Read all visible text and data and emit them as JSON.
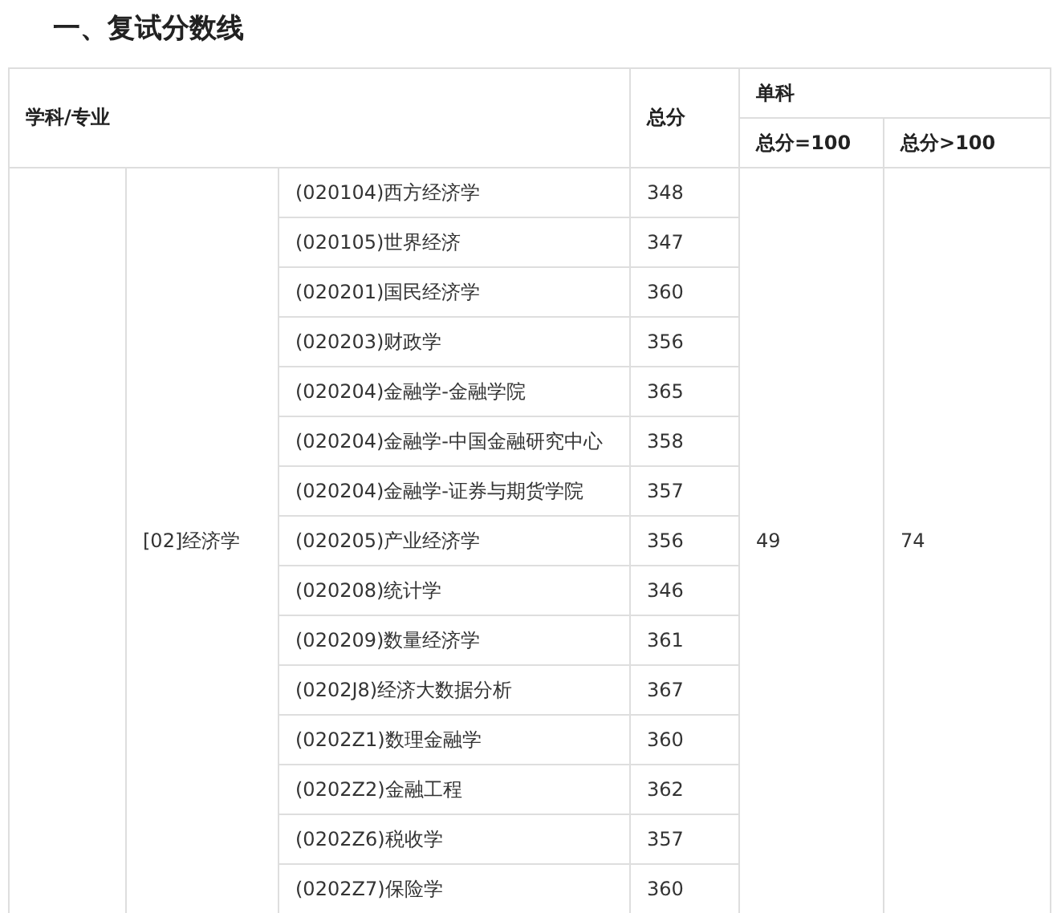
{
  "heading": "一、复试分数线",
  "table": {
    "header": {
      "subject": "学科/专业",
      "total": "总分",
      "single": "单科",
      "single_100": "总分=100",
      "single_over_100": "总分>100"
    },
    "discipline": "[02]经济学",
    "single_100": "49",
    "single_over_100": "74",
    "rows": [
      {
        "major": "(020104)西方经济学",
        "total": "348"
      },
      {
        "major": "(020105)世界经济",
        "total": "347"
      },
      {
        "major": "(020201)国民经济学",
        "total": "360"
      },
      {
        "major": "(020203)财政学",
        "total": "356"
      },
      {
        "major": "(020204)金融学-金融学院",
        "total": "365"
      },
      {
        "major": "(020204)金融学-中国金融研究中心",
        "total": "358"
      },
      {
        "major": "(020204)金融学-证券与期货学院",
        "total": "357"
      },
      {
        "major": "(020205)产业经济学",
        "total": "356"
      },
      {
        "major": "(020208)统计学",
        "total": "346"
      },
      {
        "major": "(020209)数量经济学",
        "total": "361"
      },
      {
        "major": "(0202J8)经济大数据分析",
        "total": "367"
      },
      {
        "major": "(0202Z1)数理金融学",
        "total": "360"
      },
      {
        "major": "(0202Z2)金融工程",
        "total": "362"
      },
      {
        "major": "(0202Z6)税收学",
        "total": "357"
      },
      {
        "major": "(0202Z7)保险学",
        "total": "360"
      }
    ]
  }
}
